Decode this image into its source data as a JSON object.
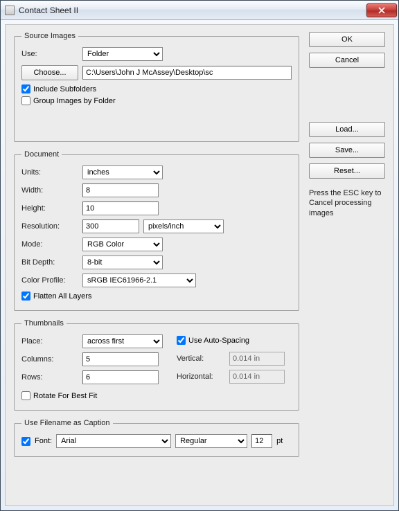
{
  "window": {
    "title": "Contact Sheet II"
  },
  "buttons": {
    "ok": "OK",
    "cancel": "Cancel",
    "load": "Load...",
    "save": "Save...",
    "reset": "Reset..."
  },
  "hint": "Press the ESC key to Cancel processing images",
  "source": {
    "legend": "Source Images",
    "use_label": "Use:",
    "use_value": "Folder",
    "choose_label": "Choose...",
    "path": "C:\\Users\\John J McAssey\\Desktop\\sc",
    "include_subfolders": {
      "label": "Include Subfolders",
      "checked": true
    },
    "group_by_folder": {
      "label": "Group Images by Folder",
      "checked": false
    }
  },
  "document": {
    "legend": "Document",
    "units": {
      "label": "Units:",
      "value": "inches"
    },
    "width": {
      "label": "Width:",
      "value": "8"
    },
    "height": {
      "label": "Height:",
      "value": "10"
    },
    "resolution": {
      "label": "Resolution:",
      "value": "300",
      "unit": "pixels/inch"
    },
    "mode": {
      "label": "Mode:",
      "value": "RGB Color"
    },
    "bit_depth": {
      "label": "Bit Depth:",
      "value": "8-bit"
    },
    "color_profile": {
      "label": "Color Profile:",
      "value": "sRGB IEC61966-2.1"
    },
    "flatten": {
      "label": "Flatten All Layers",
      "checked": true
    }
  },
  "thumbnails": {
    "legend": "Thumbnails",
    "place": {
      "label": "Place:",
      "value": "across first"
    },
    "auto_spacing": {
      "label": "Use Auto-Spacing",
      "checked": true
    },
    "columns": {
      "label": "Columns:",
      "value": "5"
    },
    "rows": {
      "label": "Rows:",
      "value": "6"
    },
    "vertical": {
      "label": "Vertical:",
      "value": "0.014 in"
    },
    "horizontal": {
      "label": "Horizontal:",
      "value": "0.014 in"
    },
    "rotate": {
      "label": "Rotate For Best Fit",
      "checked": false
    }
  },
  "caption": {
    "legend": "Use Filename as Caption",
    "enabled": true,
    "font_label": "Font:",
    "font_value": "Arial",
    "style_value": "Regular",
    "size_value": "12",
    "size_unit": "pt"
  }
}
